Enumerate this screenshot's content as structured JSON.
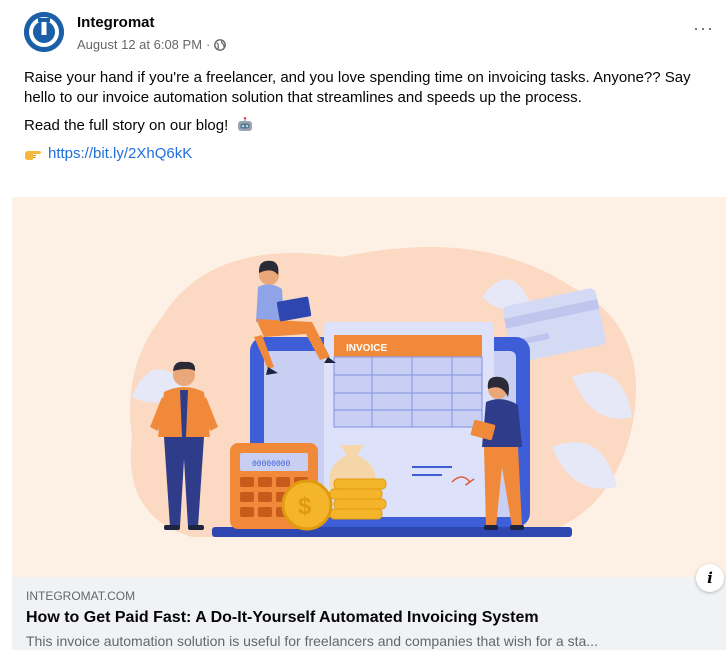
{
  "post": {
    "page_name": "Integromat",
    "timestamp": "August 12 at 6:08 PM",
    "separator": "·",
    "audience_icon": "globe-icon",
    "more_icon": "ellipsis-icon",
    "more_label": "···",
    "text_line1": "Raise your hand if you're a freelancer, and you love spending time on invoicing tasks. Anyone?? Say hello to our invoice automation solution that streamlines and speeds up the process.",
    "text_line2": "Read the full story on our blog!",
    "text_emoji": "robot-emoji-icon",
    "link_emoji": "pointing-hand-icon",
    "link_text": "https://bit.ly/2XhQ6kK"
  },
  "image": {
    "invoice_label": "INVOICE",
    "calculator_display": "00000000",
    "coin_symbol": "$"
  },
  "preview": {
    "domain": "INTEGROMAT.COM",
    "title": "How to Get Paid Fast: A Do-It-Yourself Automated Invoicing System",
    "description": "This invoice automation solution is useful for freelancers and companies that wish for a sta...",
    "info_icon": "info-icon",
    "info_label": "i"
  },
  "colors": {
    "brand": "#1a5fa8",
    "link": "#216fdb",
    "hero_bg": "#fdf1e5",
    "orange": "#f08a3a",
    "blue": "#3d5ed6",
    "lavender": "#c9cff2"
  }
}
